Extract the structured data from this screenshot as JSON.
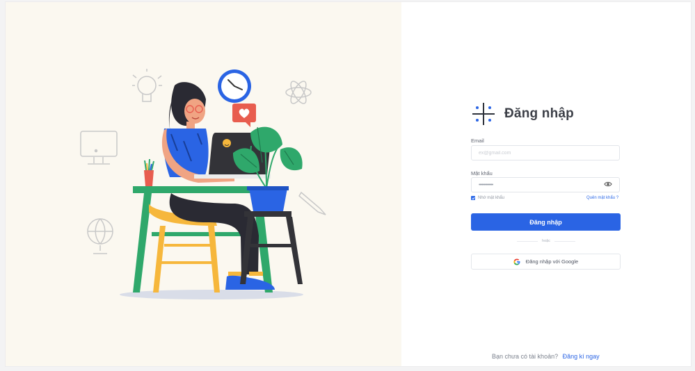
{
  "brand": {
    "title": "Đăng nhập",
    "icon": "plus-brand-icon"
  },
  "form": {
    "email_label": "Email",
    "email_placeholder": "ex@gmail.com",
    "password_label": "Mật khẩu",
    "password_value": "••••••••••••••",
    "remember_label": "Nhớ mật khẩu",
    "forgot_label": "Quên mật khẩu ?",
    "login_button": "Đăng nhập",
    "or_text": "hoặc",
    "google_button": "Đăng nhập với Google"
  },
  "footer": {
    "prompt": "Bạn chưa có tài khoản?",
    "signup_link": "Đăng kí ngay"
  },
  "colors": {
    "accent": "#2a64e4",
    "left_bg": "#fbf8f0"
  }
}
